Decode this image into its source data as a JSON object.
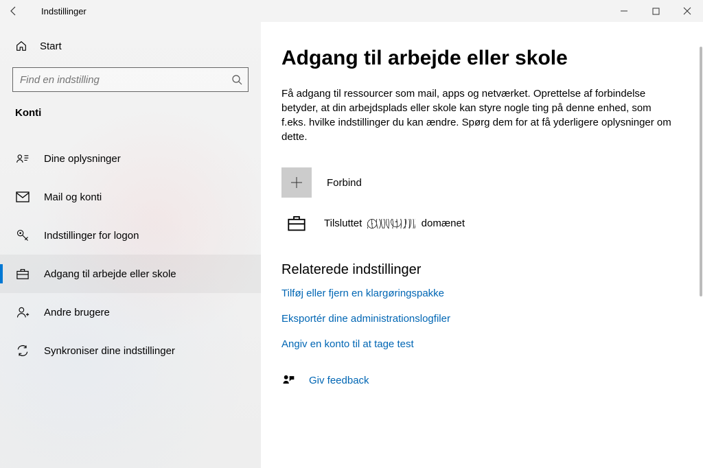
{
  "window": {
    "title": "Indstillinger"
  },
  "sidebar": {
    "home": "Start",
    "search_placeholder": "Find en indstilling",
    "section": "Konti",
    "items": [
      {
        "label": "Dine oplysninger"
      },
      {
        "label": "Mail og konti"
      },
      {
        "label": "Indstillinger for logon"
      },
      {
        "label": "Adgang til arbejde eller skole"
      },
      {
        "label": "Andre brugere"
      },
      {
        "label": "Synkroniser dine indstillinger"
      }
    ]
  },
  "main": {
    "heading": "Adgang til arbejde eller skole",
    "description": "Få adgang til ressourcer som mail, apps og netværket. Oprettelse af forbindelse betyder, at din arbejdsplads eller skole kan styre nogle ting på denne enhed, som f.eks. hvilke indstillinger du kan ændre. Spørg dem for at få yderligere oplysninger om dette.",
    "connect_label": "Forbind",
    "domain_prefix": "Tilsluttet",
    "domain_suffix": "domænet",
    "related_heading": "Relaterede indstillinger",
    "links": [
      "Tilføj eller fjern en klargøringspakke",
      "Eksportér dine administrationslogfiler",
      "Angiv en konto til at tage test"
    ],
    "feedback": "Giv feedback"
  }
}
